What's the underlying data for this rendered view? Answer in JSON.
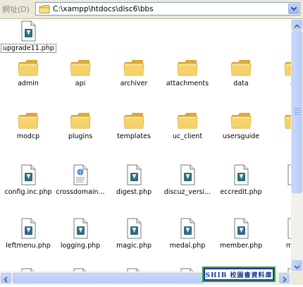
{
  "address_bar": {
    "label": "網址(D)",
    "path": "C:\\xampp\\htdocs\\disc6\\bbs"
  },
  "rows": [
    [
      {
        "name": "upgrade11.php",
        "type": "php",
        "selected": true
      }
    ],
    [
      {
        "name": "admin",
        "type": "folder"
      },
      {
        "name": "api",
        "type": "folder"
      },
      {
        "name": "archiver",
        "type": "folder"
      },
      {
        "name": "attachments",
        "type": "folder"
      },
      {
        "name": "data",
        "type": "folder"
      },
      {
        "name": "de",
        "type": "folder"
      }
    ],
    [
      {
        "name": "modcp",
        "type": "folder"
      },
      {
        "name": "plugins",
        "type": "folder"
      },
      {
        "name": "templates",
        "type": "folder"
      },
      {
        "name": "uc_client",
        "type": "folder"
      },
      {
        "name": "usersguide",
        "type": "folder"
      },
      {
        "name": "",
        "type": "folder"
      }
    ],
    [
      {
        "name": "config.inc.php",
        "type": "php"
      },
      {
        "name": "crossdomain...",
        "type": "xml"
      },
      {
        "name": "digest.php",
        "type": "php"
      },
      {
        "name": "discuz_versi...",
        "type": "php"
      },
      {
        "name": "eccredit.php",
        "type": "php"
      },
      {
        "name": "fa",
        "type": "php"
      }
    ],
    [
      {
        "name": "leftmenu.php",
        "type": "php"
      },
      {
        "name": "logging.php",
        "type": "php"
      },
      {
        "name": "magic.php",
        "type": "php"
      },
      {
        "name": "medal.php",
        "type": "php"
      },
      {
        "name": "member.php",
        "type": "php"
      },
      {
        "name": "mem",
        "type": "php"
      }
    ],
    [
      {
        "name": "",
        "type": "php"
      },
      {
        "name": "",
        "type": "php"
      },
      {
        "name": "",
        "type": "php"
      },
      {
        "name": "",
        "type": "php"
      },
      {
        "name": "",
        "type": "php"
      },
      {
        "name": "",
        "type": "php"
      }
    ]
  ],
  "watermark": "SHIB 校園書資料庫",
  "colors": {
    "folder": "#f6d36a",
    "folder_dark": "#d9a93a",
    "php_badge": "#2f6b80",
    "selection_border": "#333333"
  }
}
